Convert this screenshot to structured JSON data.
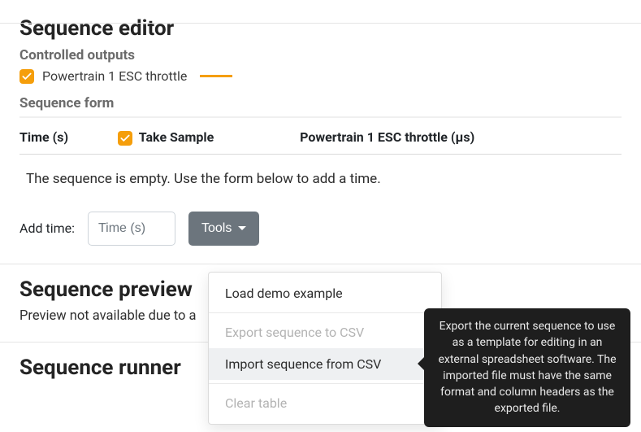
{
  "editor": {
    "title": "Sequence editor",
    "controlled_outputs_heading": "Controlled outputs",
    "output": {
      "checked": true,
      "label": "Powertrain 1 ESC throttle",
      "swatch_color": "#f59e0b"
    },
    "sequence_form_heading": "Sequence form",
    "table": {
      "headers": {
        "time": "Time (s)",
        "take_sample": "Take Sample",
        "col3": "Powertrain 1 ESC throttle (µs)"
      },
      "empty_message": "The sequence is empty. Use the form below to add a time.",
      "take_sample_checked": true
    },
    "add_time_label": "Add time:",
    "time_placeholder": "Time (s)",
    "tools_label": "Tools",
    "tools_menu": {
      "load_demo": "Load demo example",
      "export_csv": "Export sequence to CSV",
      "import_csv": "Import sequence from CSV",
      "clear": "Clear table"
    },
    "tooltip": "Export the current sequence to use as a template for editing in an external spreadsheet software. The imported file must have the same format and column headers as the exported file."
  },
  "preview": {
    "title": "Sequence preview",
    "not_available": "Preview not available due to a"
  },
  "runner": {
    "title": "Sequence runner"
  }
}
